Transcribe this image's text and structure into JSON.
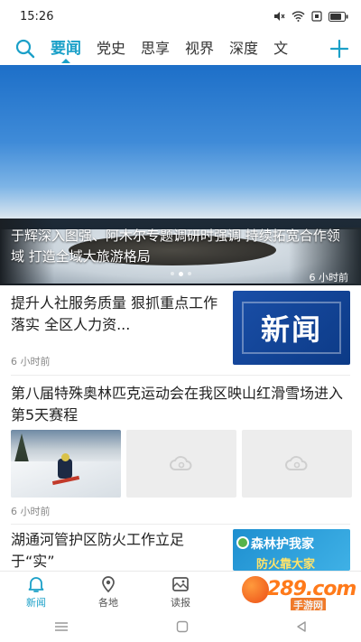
{
  "status_bar": {
    "time": "15:26"
  },
  "top_nav": {
    "tabs": [
      {
        "label": "要闻",
        "active": true
      },
      {
        "label": "党史",
        "active": false
      },
      {
        "label": "思享",
        "active": false
      },
      {
        "label": "视界",
        "active": false
      },
      {
        "label": "深度",
        "active": false
      },
      {
        "label": "文",
        "active": false
      }
    ]
  },
  "hero": {
    "caption": "于辉深入图强、阿木尔专题调研时强调 持续拓宽合作领域 打造全域大旅游格局",
    "time": "6 小时前"
  },
  "articles": [
    {
      "title": "提升人社服务质量 狠抓重点工作落实 全区人力资...",
      "time": "6 小时前",
      "thumb_text": "新闻"
    },
    {
      "title": "第八届特殊奥林匹克运动会在我区映山红滑雪场进入第5天赛程",
      "time": "6 小时前"
    },
    {
      "title": "湖通河管护区防火工作立足于“实”",
      "thumb_text_1": "森林护我家",
      "thumb_text_2": "防火靠大家"
    }
  ],
  "tab_bar": {
    "tabs": [
      {
        "label": "新闻",
        "active": true
      },
      {
        "label": "各地",
        "active": false
      },
      {
        "label": "读报",
        "active": false
      }
    ]
  },
  "watermark": {
    "text": "289.com",
    "sub": "手游网"
  },
  "colors": {
    "accent": "#1ba0c8"
  }
}
